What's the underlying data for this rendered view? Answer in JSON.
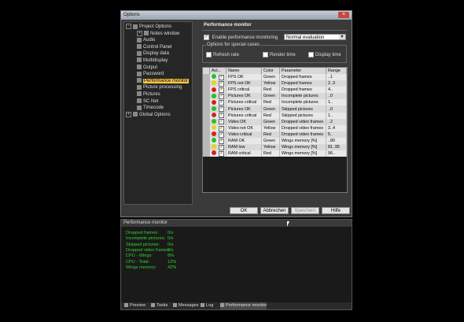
{
  "window": {
    "title": "Options",
    "close_glyph": "×"
  },
  "tree": {
    "items": [
      {
        "label": "Project Options",
        "indent": 0,
        "expander": "−",
        "icon": "project-icon"
      },
      {
        "label": "Notes window",
        "indent": 1,
        "expander": "+",
        "icon": "notes-icon"
      },
      {
        "label": "Audio",
        "indent": 1,
        "icon": "audio-icon"
      },
      {
        "label": "Control Panel",
        "indent": 1,
        "icon": "control-panel-icon"
      },
      {
        "label": "Display data",
        "indent": 1,
        "icon": "display-data-icon"
      },
      {
        "label": "Multidisplay",
        "indent": 1,
        "icon": "multidisplay-icon"
      },
      {
        "label": "Output",
        "indent": 1,
        "icon": "output-icon"
      },
      {
        "label": "Password",
        "indent": 1,
        "icon": "key-icon"
      },
      {
        "label": "Performance monitor",
        "indent": 1,
        "icon": "performance-icon",
        "selected": true
      },
      {
        "label": "Picture processing",
        "indent": 1,
        "icon": "picture-processing-icon"
      },
      {
        "label": "Pictures",
        "indent": 1,
        "icon": "pictures-icon"
      },
      {
        "label": "SC Net",
        "indent": 1,
        "icon": "network-icon"
      },
      {
        "label": "Timecode",
        "indent": 1,
        "icon": "clock-icon"
      },
      {
        "label": "Global Options",
        "indent": 0,
        "expander": "+",
        "icon": "global-icon"
      }
    ]
  },
  "panel": {
    "title": "Performance monitor",
    "enable_label": "Enable performance monitoring",
    "enable_checked": "✓",
    "evaluation_value": "Normal evaluation",
    "special_cases_label": "Options for special cases",
    "special_options": [
      "Refresh rate",
      "Render time",
      "Display time"
    ]
  },
  "table": {
    "headers": [
      "",
      "Act...",
      "Name",
      "Color",
      "Parameter",
      "Range"
    ],
    "rows": [
      {
        "status": "#22c422",
        "active": "✓",
        "name": "FPS OK",
        "color": "Green",
        "parameter": "Dropped frames",
        "range": "..1"
      },
      {
        "status": "#e8d21a",
        "active": "✓",
        "name": "FPS not OK",
        "color": "Yellow",
        "parameter": "Dropped frames",
        "range": "2..3"
      },
      {
        "status": "#d82020",
        "active": "✓",
        "name": "FPS critical",
        "color": "Red",
        "parameter": "Dropped frames",
        "range": "4.."
      },
      {
        "status": "#22c422",
        "active": "✓",
        "name": "Pictures OK",
        "color": "Green",
        "parameter": "Incomplete pictures",
        "range": "..0"
      },
      {
        "status": "#d82020",
        "active": "✓",
        "name": "Pictures critical",
        "color": "Red",
        "parameter": "Incomplete pictures",
        "range": "1.."
      },
      {
        "status": "#22c422",
        "active": "✓",
        "name": "Pictures OK",
        "color": "Green",
        "parameter": "Skipped pictures",
        "range": "..0"
      },
      {
        "status": "#d82020",
        "active": "✓",
        "name": "Pictures critical",
        "color": "Red",
        "parameter": "Skipped pictures",
        "range": "1.."
      },
      {
        "status": "#22c422",
        "active": "✓",
        "name": "Video OK",
        "color": "Green",
        "parameter": "Dropped video frames",
        "range": "..2"
      },
      {
        "status": "#e8d21a",
        "active": "✓",
        "name": "Video not OK",
        "color": "Yellow",
        "parameter": "Dropped video frames",
        "range": "3..4"
      },
      {
        "status": "#d82020",
        "active": "✓",
        "name": "Video critical",
        "color": "Red",
        "parameter": "Dropped video frames",
        "range": "5.."
      },
      {
        "status": "#22c422",
        "active": "✓",
        "name": "RAM OK",
        "color": "Green",
        "parameter": "Wings memory [%]",
        "range": "..80"
      },
      {
        "status": "#e8d21a",
        "active": "✓",
        "name": "RAM low",
        "color": "Yellow",
        "parameter": "Wings memory [%]",
        "range": "81..95"
      },
      {
        "status": "#d82020",
        "active": "✓",
        "name": "RAM critical",
        "color": "Red",
        "parameter": "Wings memory [%]",
        "range": "96.."
      }
    ]
  },
  "buttons": {
    "ok": "OK",
    "cancel": "Abbrechen",
    "save": "Speichern",
    "help": "Hilfe"
  },
  "monitor": {
    "title": "Performance monitor",
    "lines": [
      {
        "label": "Dropped frames:",
        "value": "0/s"
      },
      {
        "label": "Incomplete pictures:",
        "value": "0/s"
      },
      {
        "label": "Skipped pictures:",
        "value": "0/s"
      },
      {
        "label": "Dropped video frames:",
        "value": "0/s"
      },
      {
        "label": "CPU - Wings:",
        "value": "8%"
      },
      {
        "label": "CPU - Total:",
        "value": "12%"
      },
      {
        "label": "Wings memory:",
        "value": "42%"
      }
    ],
    "tabs": [
      {
        "label": "Preview",
        "icon": "preview-icon"
      },
      {
        "label": "Tasks",
        "icon": "tasks-icon"
      },
      {
        "label": "Messages",
        "icon": "messages-icon"
      },
      {
        "label": "Log",
        "icon": "log-icon"
      },
      {
        "label": "Performance monitor",
        "icon": "performance-icon",
        "active": true
      }
    ]
  },
  "colors": {
    "green_text": "#2fd12f",
    "selection": "#f5c84a"
  }
}
